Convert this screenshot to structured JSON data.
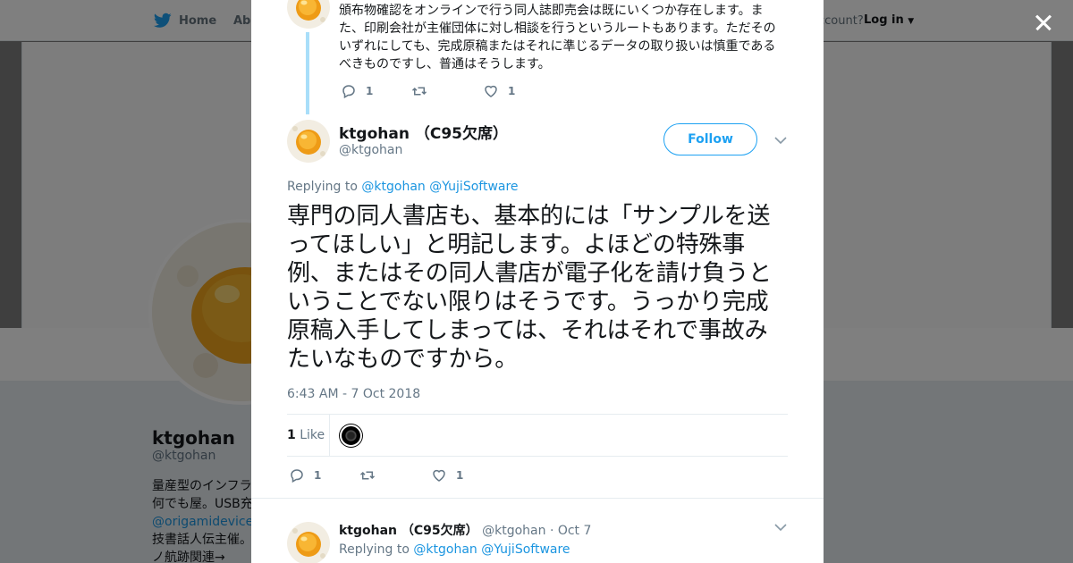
{
  "background": {
    "nav": {
      "home": "Home",
      "about": "Abo",
      "account_prompt": "ccount?",
      "login": "Log in"
    },
    "profile": {
      "name": "ktgohan （C",
      "handle": "@ktgohan",
      "bio_lines": [
        "量産型のインフラ",
        "何でも屋。USB充"
      ],
      "bio_link": "@origamidevices",
      "bio_more": [
        "技書話人伝主催。",
        "ノ航跡関連→"
      ]
    }
  },
  "previous_tweet": {
    "text": "頒布物確認をオンラインで行う同人誌即売会は既にいくつか存在します。また、印刷会社が主催団体に対し相談を行うというルートもあります。ただそのいずれにしても、完成原稿またはそれに準じるデータの取り扱いは慎重であるべきものですし、普通はそうします。",
    "reply_count": "1",
    "like_count": "1"
  },
  "tweet": {
    "author_name": "ktgohan （C95欠席）",
    "author_handle": "@ktgohan",
    "follow_label": "Follow",
    "replying_label": "Replying to",
    "mentions": [
      "@ktgohan",
      "@YujiSoftware"
    ],
    "text": "専門の同人書店も、基本的には「サンプルを送ってほしい」と明記します。よほどの特殊事例、またはその同人書店が電子化を請け負うということでない限りはそうです。うっかり完成原稿入手してしまっては、それはそれで事故みたいなものですから。",
    "timestamp": "6:43 AM - 7 Oct 2018",
    "likes_count": "1",
    "likes_label": "Like",
    "reply_count": "1",
    "like_count": "1"
  },
  "next_tweet": {
    "author_name": "ktgohan （C95欠席）",
    "author_handle": "@ktgohan",
    "separator": "·",
    "date": "Oct 7",
    "replying_label": "Replying to",
    "mentions": [
      "@ktgohan",
      "@YujiSoftware"
    ]
  },
  "icons": {
    "close": "close-icon",
    "reply": "reply-icon",
    "retweet": "retweet-icon",
    "like": "heart-icon",
    "more": "chevron-down-icon",
    "logo": "twitter-bird-icon"
  },
  "colors": {
    "accent": "#1da1f2",
    "link": "#1b95e0",
    "muted": "#657786",
    "thread_line": "#a9def9"
  }
}
